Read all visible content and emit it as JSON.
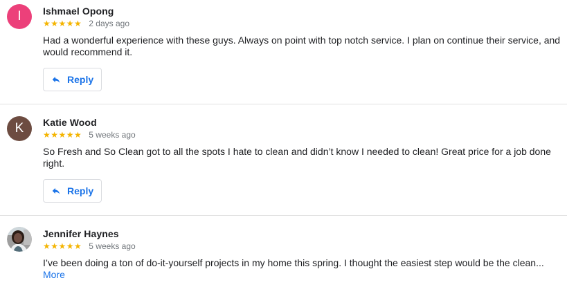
{
  "reviews": [
    {
      "avatar_initial": "I",
      "avatar_color": "#ec407a",
      "name": "Ishmael Opong",
      "stars": "★★★★★",
      "rating": 5,
      "time": "2 days ago",
      "text": "Had a wonderful experience with these guys. Always on point with top notch service. I plan on continue their service, and would recommend it.",
      "reply_label": "Reply"
    },
    {
      "avatar_initial": "K",
      "avatar_color": "#6d4c41",
      "name": "Katie Wood",
      "stars": "★★★★★",
      "rating": 5,
      "time": "5 weeks ago",
      "text": "So Fresh and So Clean got to all the spots I hate to clean and didn’t know I needed to clean! Great price for a job done right.",
      "reply_label": "Reply"
    },
    {
      "name": "Jennifer Haynes",
      "stars": "★★★★★",
      "rating": 5,
      "time": "5 weeks ago",
      "text": "I’ve been doing a ton of do-it-yourself projects in my home this spring. I thought the easiest step would be the clean...",
      "more_label": "More"
    }
  ],
  "colors": {
    "star": "#f4b400",
    "link": "#1a73e8",
    "divider": "#e0e0e0"
  }
}
